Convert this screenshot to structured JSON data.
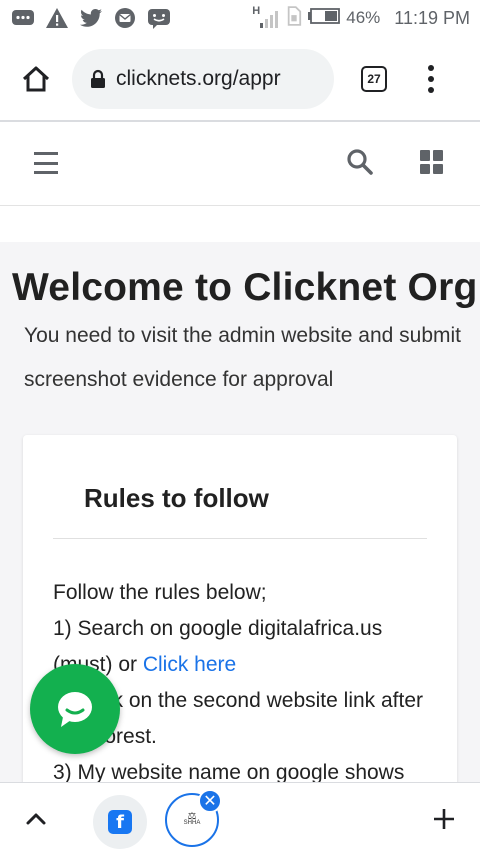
{
  "status_bar": {
    "icons": [
      "message-icon",
      "warning-icon",
      "twitter-icon",
      "gmail-icon",
      "chat-bubble-icon"
    ],
    "network": "H",
    "battery": "46%",
    "time": "11:19 PM"
  },
  "browser": {
    "url": "clicknets.org/appr",
    "tab_count": "27"
  },
  "page": {
    "title": "Welcome to Clicknet Org",
    "intro": "You need to visit the admin website and submit screenshot evidence for approval",
    "card": {
      "title": "Rules to follow",
      "line1": "Follow the rules below;",
      "line2": "1) Search on google digitalafrica.us",
      "line3_prefix": "(must) or ",
      "link": "Click here",
      "line4": "2) Click on the second website link after",
      "line5": "codeforest.",
      "line6": "3) My website name on google shows"
    }
  },
  "bottom_bar": {
    "site_tab_label": "SHHA"
  }
}
